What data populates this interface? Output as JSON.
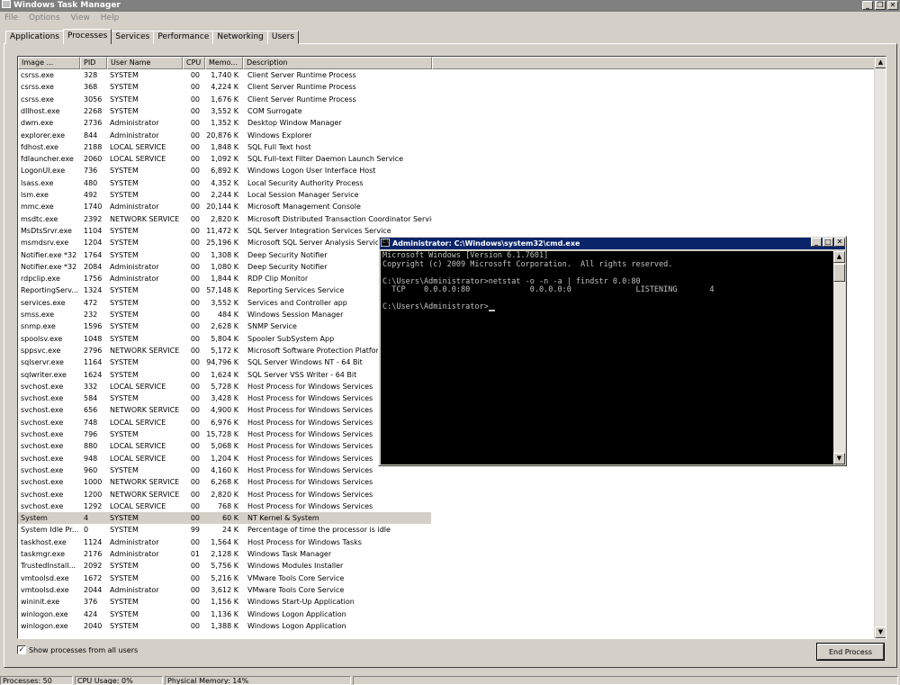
{
  "window": {
    "title": "Windows Task Manager"
  },
  "menu": [
    "File",
    "Options",
    "View",
    "Help"
  ],
  "tabs": [
    "Applications",
    "Processes",
    "Services",
    "Performance",
    "Networking",
    "Users"
  ],
  "active_tab": "Processes",
  "columns": [
    "Image ...",
    "PID",
    "User Name",
    "CPU",
    "Memo...",
    "Description"
  ],
  "processes": [
    [
      "csrss.exe",
      "328",
      "SYSTEM",
      "00",
      "1,740 K",
      "Client Server Runtime Process"
    ],
    [
      "csrss.exe",
      "368",
      "SYSTEM",
      "00",
      "4,224 K",
      "Client Server Runtime Process"
    ],
    [
      "csrss.exe",
      "3056",
      "SYSTEM",
      "00",
      "1,676 K",
      "Client Server Runtime Process"
    ],
    [
      "dllhost.exe",
      "2268",
      "SYSTEM",
      "00",
      "3,552 K",
      "COM Surrogate"
    ],
    [
      "dwm.exe",
      "2736",
      "Administrator",
      "00",
      "1,352 K",
      "Desktop Window Manager"
    ],
    [
      "explorer.exe",
      "844",
      "Administrator",
      "00",
      "20,876 K",
      "Windows Explorer"
    ],
    [
      "fdhost.exe",
      "2188",
      "LOCAL SERVICE",
      "00",
      "1,848 K",
      "SQL Full Text host"
    ],
    [
      "fdlauncher.exe",
      "2060",
      "LOCAL SERVICE",
      "00",
      "1,092 K",
      "SQL Full-text Filter Daemon Launch Service"
    ],
    [
      "LogonUI.exe",
      "736",
      "SYSTEM",
      "00",
      "6,892 K",
      "Windows Logon User Interface Host"
    ],
    [
      "lsass.exe",
      "480",
      "SYSTEM",
      "00",
      "4,352 K",
      "Local Security Authority Process"
    ],
    [
      "lsm.exe",
      "492",
      "SYSTEM",
      "00",
      "2,244 K",
      "Local Session Manager Service"
    ],
    [
      "mmc.exe",
      "1740",
      "Administrator",
      "00",
      "20,144 K",
      "Microsoft Management Console"
    ],
    [
      "msdtc.exe",
      "2392",
      "NETWORK SERVICE",
      "00",
      "2,820 K",
      "Microsoft Distributed Transaction Coordinator Service"
    ],
    [
      "MsDtsSrvr.exe",
      "1104",
      "SYSTEM",
      "00",
      "11,472 K",
      "SQL Server Integration Services Service"
    ],
    [
      "msmdsrv.exe",
      "1204",
      "SYSTEM",
      "00",
      "25,196 K",
      "Microsoft SQL Server Analysis Services"
    ],
    [
      "Notifier.exe *32",
      "1764",
      "SYSTEM",
      "00",
      "1,308 K",
      "Deep Security Notifier"
    ],
    [
      "Notifier.exe *32",
      "2084",
      "Administrator",
      "00",
      "1,080 K",
      "Deep Security Notifier"
    ],
    [
      "rdpclip.exe",
      "1756",
      "Administrator",
      "00",
      "1,844 K",
      "RDP Clip Monitor"
    ],
    [
      "ReportingServ...",
      "1324",
      "SYSTEM",
      "00",
      "57,148 K",
      "Reporting Services Service"
    ],
    [
      "services.exe",
      "472",
      "SYSTEM",
      "00",
      "3,552 K",
      "Services and Controller app"
    ],
    [
      "smss.exe",
      "232",
      "SYSTEM",
      "00",
      "484 K",
      "Windows Session Manager"
    ],
    [
      "snmp.exe",
      "1596",
      "SYSTEM",
      "00",
      "2,628 K",
      "SNMP Service"
    ],
    [
      "spoolsv.exe",
      "1048",
      "SYSTEM",
      "00",
      "5,804 K",
      "Spooler SubSystem App"
    ],
    [
      "sppsvc.exe",
      "2796",
      "NETWORK SERVICE",
      "00",
      "5,172 K",
      "Microsoft Software Protection Platform"
    ],
    [
      "sqlservr.exe",
      "1164",
      "SYSTEM",
      "00",
      "94,796 K",
      "SQL Server Windows NT - 64 Bit"
    ],
    [
      "sqlwriter.exe",
      "1624",
      "SYSTEM",
      "00",
      "1,624 K",
      "SQL Server VSS Writer - 64 Bit"
    ],
    [
      "svchost.exe",
      "332",
      "LOCAL SERVICE",
      "00",
      "5,728 K",
      "Host Process for Windows Services"
    ],
    [
      "svchost.exe",
      "584",
      "SYSTEM",
      "00",
      "3,428 K",
      "Host Process for Windows Services"
    ],
    [
      "svchost.exe",
      "656",
      "NETWORK SERVICE",
      "00",
      "4,900 K",
      "Host Process for Windows Services"
    ],
    [
      "svchost.exe",
      "748",
      "LOCAL SERVICE",
      "00",
      "6,976 K",
      "Host Process for Windows Services"
    ],
    [
      "svchost.exe",
      "796",
      "SYSTEM",
      "00",
      "15,728 K",
      "Host Process for Windows Services"
    ],
    [
      "svchost.exe",
      "880",
      "LOCAL SERVICE",
      "00",
      "5,068 K",
      "Host Process for Windows Services"
    ],
    [
      "svchost.exe",
      "948",
      "LOCAL SERVICE",
      "00",
      "1,204 K",
      "Host Process for Windows Services"
    ],
    [
      "svchost.exe",
      "960",
      "SYSTEM",
      "00",
      "4,160 K",
      "Host Process for Windows Services"
    ],
    [
      "svchost.exe",
      "1000",
      "NETWORK SERVICE",
      "00",
      "6,268 K",
      "Host Process for Windows Services"
    ],
    [
      "svchost.exe",
      "1200",
      "NETWORK SERVICE",
      "00",
      "2,820 K",
      "Host Process for Windows Services"
    ],
    [
      "svchost.exe",
      "1292",
      "LOCAL SERVICE",
      "00",
      "768 K",
      "Host Process for Windows Services"
    ],
    [
      "System",
      "4",
      "SYSTEM",
      "00",
      "60 K",
      "NT Kernel & System"
    ],
    [
      "System Idle Pr...",
      "0",
      "SYSTEM",
      "99",
      "24 K",
      "Percentage of time the processor is idle"
    ],
    [
      "taskhost.exe",
      "1124",
      "Administrator",
      "00",
      "1,564 K",
      "Host Process for Windows Tasks"
    ],
    [
      "taskmgr.exe",
      "2176",
      "Administrator",
      "01",
      "2,128 K",
      "Windows Task Manager"
    ],
    [
      "TrustedInstall...",
      "2092",
      "SYSTEM",
      "00",
      "5,756 K",
      "Windows Modules Installer"
    ],
    [
      "vmtoolsd.exe",
      "1672",
      "SYSTEM",
      "00",
      "5,216 K",
      "VMware Tools Core Service"
    ],
    [
      "vmtoolsd.exe",
      "2044",
      "Administrator",
      "00",
      "3,612 K",
      "VMware Tools Core Service"
    ],
    [
      "wininit.exe",
      "376",
      "SYSTEM",
      "00",
      "1,156 K",
      "Windows Start-Up Application"
    ],
    [
      "winlogon.exe",
      "424",
      "SYSTEM",
      "00",
      "1,136 K",
      "Windows Logon Application"
    ],
    [
      "winlogon.exe",
      "2040",
      "SYSTEM",
      "00",
      "1,388 K",
      "Windows Logon Application"
    ]
  ],
  "selected_process": "System",
  "show_all": {
    "label": "Show processes from all users",
    "checked": true
  },
  "end_process_label": "End Process",
  "status": {
    "processes": "Processes: 50",
    "cpu": "CPU Usage: 0%",
    "memory": "Physical Memory: 14%"
  },
  "cmd": {
    "title": "Administrator: C:\\Windows\\system32\\cmd.exe",
    "lines": [
      "Microsoft Windows [Version 6.1.7601]",
      "Copyright (c) 2009 Microsoft Corporation.  All rights reserved.",
      "",
      "C:\\Users\\Administrator>netstat -o -n -a | findstr 0.0:80",
      "  TCP    0.0.0.0:80             0.0.0.0:0              LISTENING       4",
      "",
      "C:\\Users\\Administrator>"
    ]
  },
  "colors": {
    "title_inactive": "#808080",
    "cmd_title": "#0a246a",
    "face": "#d4d0c8",
    "console_bg": "#000000",
    "console_fg": "#c0c0c0"
  }
}
